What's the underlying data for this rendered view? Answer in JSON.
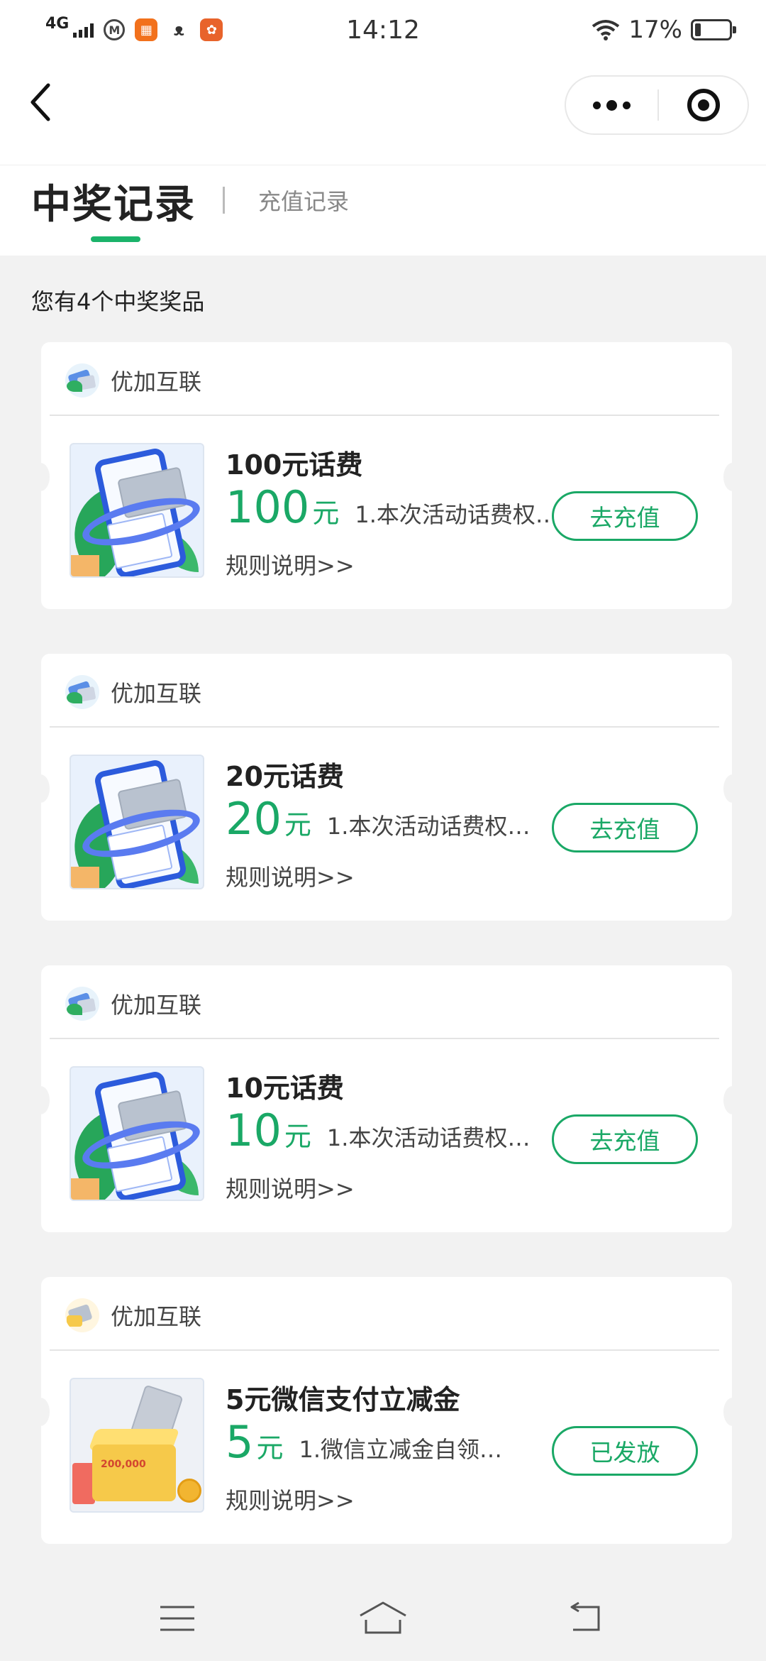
{
  "status_bar": {
    "network": "4G",
    "time": "14:12",
    "battery": "17%",
    "battery_level": 0.17,
    "app_icons": [
      "metro-icon",
      "orange-app-icon",
      "cat-app-icon",
      "colorful-app-icon"
    ]
  },
  "tabs": {
    "active": "中奖记录",
    "inactive": "充值记录"
  },
  "summary": "您有4个中奖奖品",
  "accent_color": "#1aa866",
  "cards": [
    {
      "merchant": "优加互联",
      "title": "100元话费",
      "amount": "100",
      "unit": "元",
      "desc": "1.本次活动话费权…",
      "rules": "规则说明>>",
      "button": "去充值",
      "image": "phone-bill-image"
    },
    {
      "merchant": "优加互联",
      "title": "20元话费",
      "amount": "20",
      "unit": "元",
      "desc": "1.本次活动话费权…",
      "rules": "规则说明>>",
      "button": "去充值",
      "image": "phone-bill-image"
    },
    {
      "merchant": "优加互联",
      "title": "10元话费",
      "amount": "10",
      "unit": "元",
      "desc": "1.本次活动话费权…",
      "rules": "规则说明>>",
      "button": "去充值",
      "image": "phone-bill-image"
    },
    {
      "merchant": "优加互联",
      "title": "5元微信支付立减金",
      "amount": "5",
      "unit": "元",
      "desc": "1.微信立减金自领…",
      "rules": "规则说明>>",
      "button": "已发放",
      "image": "wechat-coupon-image",
      "image_label": "200,000"
    }
  ]
}
